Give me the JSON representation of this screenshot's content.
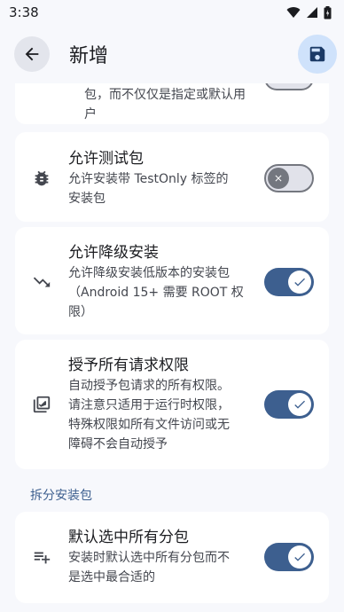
{
  "status_bar": {
    "time": "3:38"
  },
  "app_bar": {
    "title": "新增"
  },
  "partial_item": {
    "summary_lines": [
      "包，而不仅仅是指定或默认用",
      "户"
    ]
  },
  "items": [
    {
      "title": "允许测试包",
      "summary": [
        "允许安装带 TestOnly 标签的",
        "安装包"
      ],
      "icon": "bug-icon",
      "enabled": false
    },
    {
      "title": "允许降级安装",
      "summary": [
        "允许降级安装低版本的安装包",
        "（Android 15+ 需要 ROOT 权",
        "限）"
      ],
      "icon": "trending-down-icon",
      "enabled": true
    },
    {
      "title": "授予所有请求权限",
      "summary": [
        "自动授予包请求的所有权限。",
        "请注意只适用于运行时权限，",
        "特殊权限如所有文件访问或无",
        "障碍不会自动授予"
      ],
      "icon": "checklist-icon",
      "enabled": true
    }
  ],
  "section": {
    "title": "拆分安装包"
  },
  "split_item": {
    "title": "默认选中所有分包",
    "summary": [
      "安装时默认选中所有分包而不",
      "是选中最合适的"
    ],
    "icon": "playlist-add-icon",
    "enabled": true
  },
  "colors": {
    "accent": "#3d5f8f",
    "background": "#f7f8fc",
    "card": "#ffffff"
  }
}
